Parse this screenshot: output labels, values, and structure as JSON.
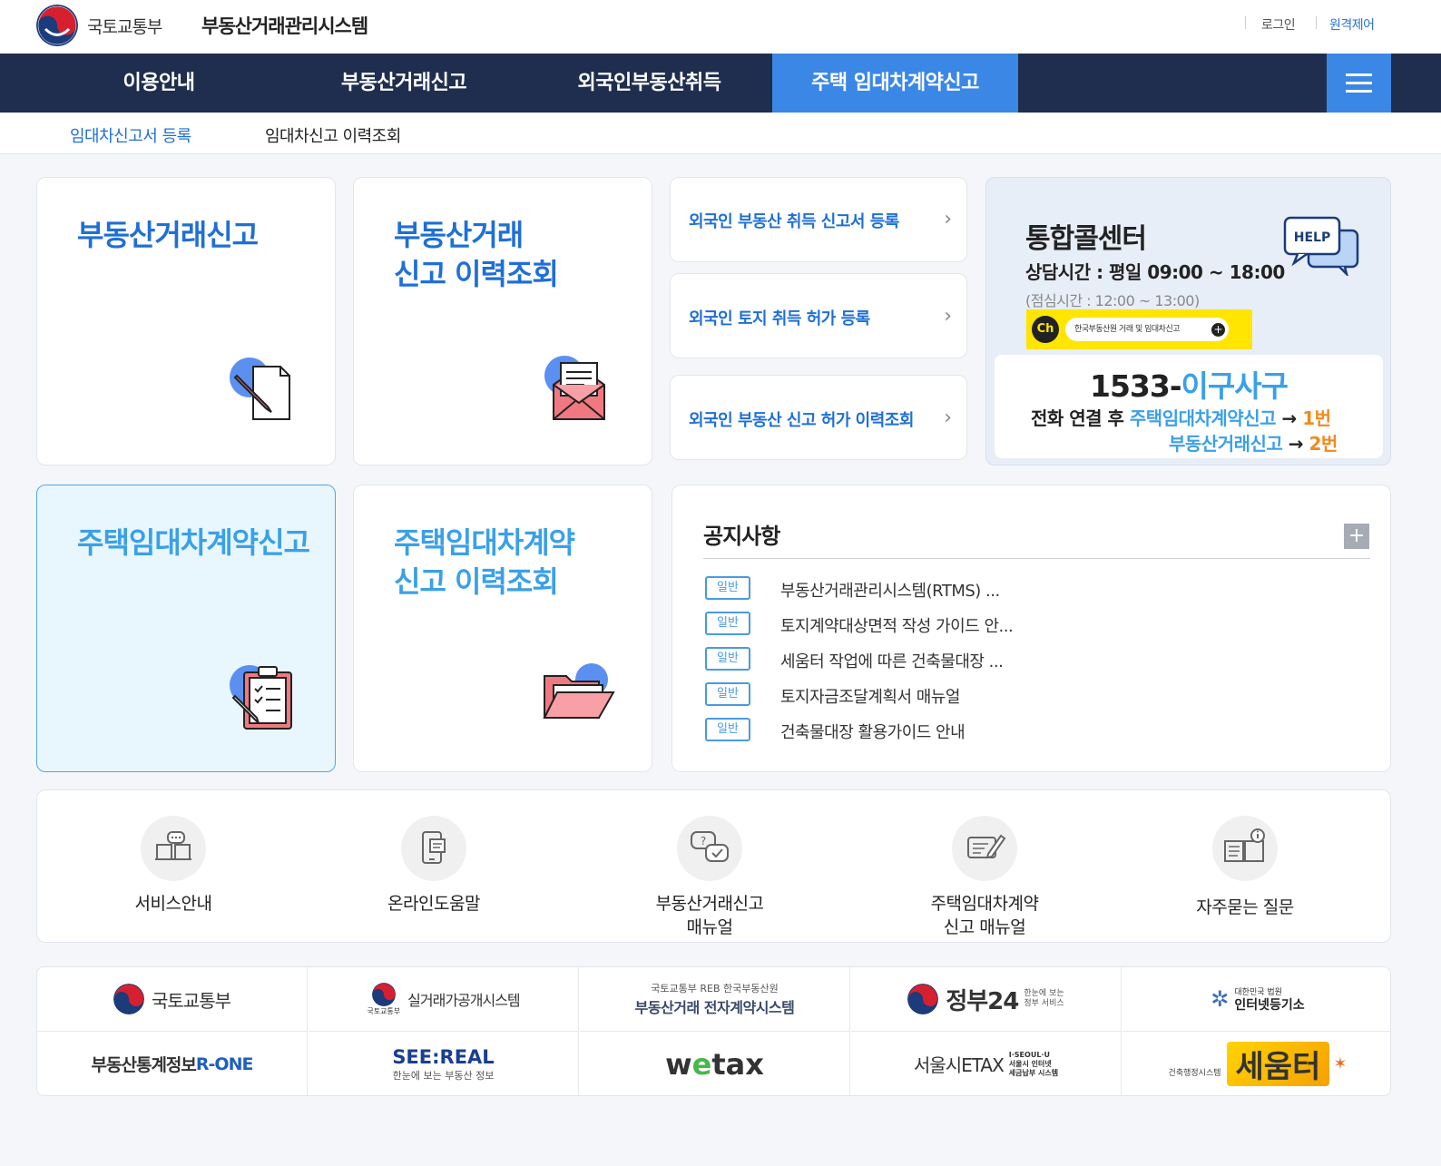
{
  "header": {
    "org_name": "국토교통부",
    "system_name": "부동산거래관리시스템",
    "login": "로그인",
    "remote": "원격제어"
  },
  "gnb": {
    "items": [
      {
        "label": "이용안내"
      },
      {
        "label": "부동산거래신고"
      },
      {
        "label": "외국인부동산취득"
      },
      {
        "label": "주택 임대차계약신고"
      }
    ],
    "active_index": 3
  },
  "subnav": {
    "items": [
      {
        "label": "임대차신고서 등록"
      },
      {
        "label": "임대차신고 이력조회"
      }
    ]
  },
  "cards": {
    "real_estate_report": {
      "title": "부동산거래신고"
    },
    "real_estate_history": {
      "line1": "부동산거래",
      "line2": "신고 이력조회"
    },
    "lease_report": {
      "title": "주택임대차계약신고"
    },
    "lease_history": {
      "line1": "주택임대차계약",
      "line2": "신고 이력조회"
    }
  },
  "foreign_links": [
    {
      "label": "외국인 부동산 취득 신고서 등록"
    },
    {
      "label": "외국인 토지 취득 허가 등록"
    },
    {
      "label": "외국인 부동산 신고 허가 이력조회"
    }
  ],
  "call_center": {
    "title": "통합콜센터",
    "hours": "상담시간 : 평일 09:00 ~ 18:00",
    "lunch": "(점심시간 : 12:00 ~ 13:00)",
    "kakao_ch": "Ch",
    "kakao_text": "한국부동산원 거래 및 임대차신고",
    "help_label": "HELP",
    "phone_number": "1533-",
    "phone_word": "이구사구",
    "line1_prefix": "전화 연결 후 ",
    "line1_service": "주택임대차계약신고",
    "line1_arrow": " → ",
    "line1_option": "1번",
    "line2_service": "부동산거래신고",
    "line2_arrow": " → ",
    "line2_option": "2번"
  },
  "notices": {
    "title": "공지사항",
    "more": "+",
    "items": [
      {
        "badge": "일반",
        "text": "부동산거래관리시스템(RTMS) ..."
      },
      {
        "badge": "일반",
        "text": "토지계약대상면적 작성 가이드 안..."
      },
      {
        "badge": "일반",
        "text": "세움터 작업에 따른 건축물대장 ..."
      },
      {
        "badge": "일반",
        "text": "토지자금조달계획서 매뉴얼"
      },
      {
        "badge": "일반",
        "text": "건축물대장 활용가이드 안내"
      }
    ]
  },
  "quick_menu": [
    {
      "line1": "서비스안내",
      "line2": ""
    },
    {
      "line1": "온라인도움말",
      "line2": ""
    },
    {
      "line1": "부동산거래신고",
      "line2": "매뉴얼"
    },
    {
      "line1": "주택임대차계약",
      "line2": "신고 매뉴얼"
    },
    {
      "line1": "자주묻는 질문",
      "line2": ""
    }
  ],
  "banners": {
    "molit": "국토교통부",
    "rtms_open": "실거래가공개시스템",
    "rtms_open_sub": "국토교통부",
    "econtract_top": "국토교통부  REB 한국부동산원",
    "econtract": "부동산거래 전자계약시스템",
    "gov24": "정부24",
    "gov24_sub1": "한눈에 보는",
    "gov24_sub2": "정부 서비스",
    "iros_top": "대한민국 법원",
    "iros": "인터넷등기소",
    "rone_prefix": "부동산통계정보 ",
    "rone": "R-ONE",
    "seereal": "SEE:REAL",
    "seereal_sub": "한눈에 보는 부동산 정보",
    "wetax_w": "w",
    "wetax_e": "e",
    "wetax_rest": "tax",
    "etax": "서울시ETAX",
    "etax_sub1": "I·SEOUL·U",
    "etax_sub2": "서울시 인터넷",
    "etax_sub3": "세금납부 시스템",
    "seumteo": "세움터",
    "seumteo_sub": "건축행정시스템"
  }
}
